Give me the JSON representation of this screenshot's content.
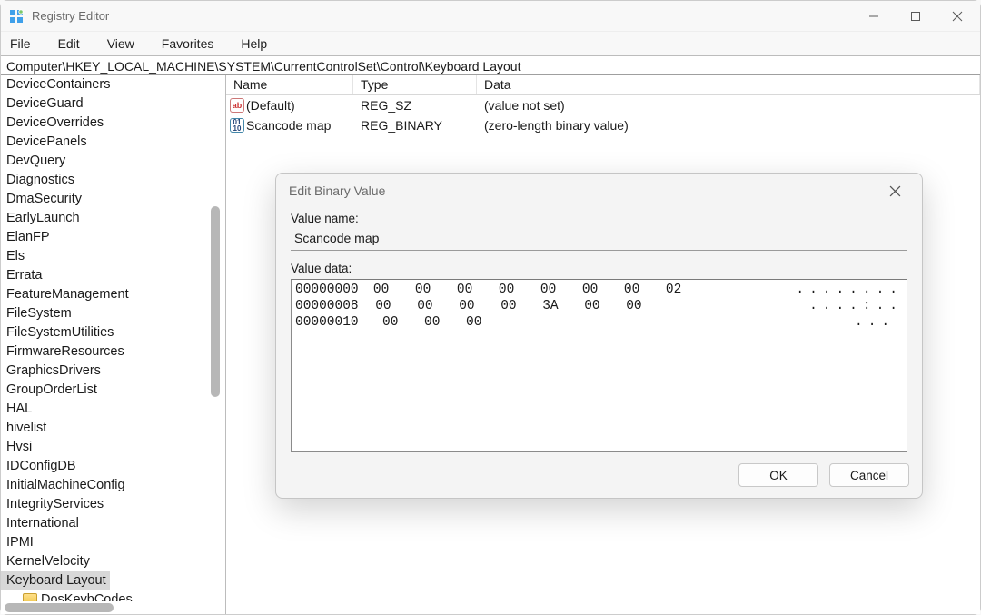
{
  "titlebar": {
    "title": "Registry Editor"
  },
  "menubar": [
    "File",
    "Edit",
    "View",
    "Favorites",
    "Help"
  ],
  "address": "Computer\\HKEY_LOCAL_MACHINE\\SYSTEM\\CurrentControlSet\\Control\\Keyboard Layout",
  "tree": {
    "items": [
      {
        "label": "DeviceContainers"
      },
      {
        "label": "DeviceGuard"
      },
      {
        "label": "DeviceOverrides"
      },
      {
        "label": "DevicePanels"
      },
      {
        "label": "DevQuery"
      },
      {
        "label": "Diagnostics"
      },
      {
        "label": "DmaSecurity"
      },
      {
        "label": "EarlyLaunch"
      },
      {
        "label": "ElanFP"
      },
      {
        "label": "Els"
      },
      {
        "label": "Errata"
      },
      {
        "label": "FeatureManagement"
      },
      {
        "label": "FileSystem"
      },
      {
        "label": "FileSystemUtilities"
      },
      {
        "label": "FirmwareResources"
      },
      {
        "label": "GraphicsDrivers"
      },
      {
        "label": "GroupOrderList"
      },
      {
        "label": "HAL"
      },
      {
        "label": "hivelist"
      },
      {
        "label": "Hvsi"
      },
      {
        "label": "IDConfigDB"
      },
      {
        "label": "InitialMachineConfig"
      },
      {
        "label": "IntegrityServices"
      },
      {
        "label": "International"
      },
      {
        "label": "IPMI"
      },
      {
        "label": "KernelVelocity"
      },
      {
        "label": "Keyboard Layout",
        "selected": true
      },
      {
        "label": "DosKeybCodes",
        "child": true,
        "folder": true
      }
    ]
  },
  "values": {
    "headers": {
      "name": "Name",
      "type": "Type",
      "data": "Data"
    },
    "rows": [
      {
        "icon": "sz",
        "name": "(Default)",
        "type": "REG_SZ",
        "data": "(value not set)"
      },
      {
        "icon": "bin",
        "name": "Scancode map",
        "type": "REG_BINARY",
        "data": "(zero-length binary value)"
      }
    ]
  },
  "dialog": {
    "title": "Edit Binary Value",
    "value_name_label": "Value name:",
    "value_name": "Scancode map",
    "value_data_label": "Value data:",
    "hex": [
      {
        "offset": "00000000",
        "bytes": [
          "00",
          "00",
          "00",
          "00",
          "00",
          "00",
          "00",
          "02"
        ],
        "ascii": "........"
      },
      {
        "offset": "00000008",
        "bytes": [
          "00",
          "00",
          "00",
          "00",
          "3A",
          "00",
          "00",
          ""
        ],
        "ascii": "....:.."
      },
      {
        "offset": "00000010",
        "bytes": [
          "00",
          "00",
          "00",
          "",
          "",
          "",
          "",
          ""
        ],
        "ascii": "..."
      }
    ],
    "ok_label": "OK",
    "cancel_label": "Cancel"
  }
}
